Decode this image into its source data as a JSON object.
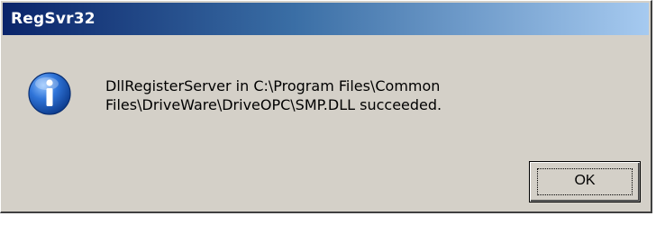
{
  "window": {
    "title": "RegSvr32",
    "message": "DllRegisterServer in C:\\Program Files\\Common\nFiles\\DriveWare\\DriveOPC\\SMP.DLL succeeded.",
    "icon": "info-icon"
  },
  "buttons": {
    "ok_label": "OK"
  },
  "colors": {
    "titlebar_start": "#0a246a",
    "titlebar_end": "#a6caf0",
    "dialog_bg": "#d4d0c8",
    "icon_blue": "#1b5fc4"
  }
}
